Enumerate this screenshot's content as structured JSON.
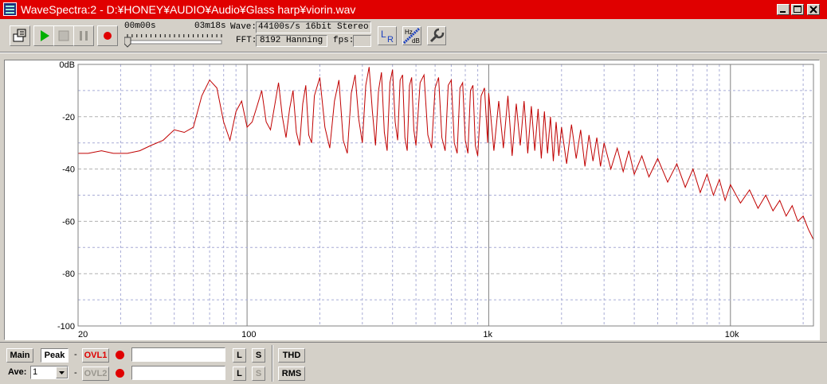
{
  "window": {
    "title": "WaveSpectra:2 - D:¥HONEY¥AUDIO¥Audio¥Glass harp¥viorin.wav",
    "icon": "wavespectra-app-icon"
  },
  "toolbar": {
    "time_start": "00m00s",
    "time_end": "03m18s",
    "wave_label": "Wave:",
    "wave_value": "44100s/s 16bit Stereo",
    "fft_label": "FFT:",
    "fft_value": "8192 Hanning",
    "fps_label": "fps:",
    "fps_value": "",
    "position_fraction": 0.0,
    "icons": [
      "open-file-icon",
      "play-icon",
      "stop-icon",
      "pause-icon",
      "record-icon",
      "lr-channel-icon",
      "hz-db-scale-icon",
      "settings-wrench-icon"
    ]
  },
  "chart_data": {
    "type": "line",
    "x_scale": "log",
    "xlim": [
      20,
      22050
    ],
    "ylim": [
      -100,
      0
    ],
    "x_ticks": [
      {
        "value": 20,
        "label": "20"
      },
      {
        "value": 100,
        "label": "100"
      },
      {
        "value": 1000,
        "label": "1k"
      },
      {
        "value": 10000,
        "label": "10k"
      }
    ],
    "y_ticks": [
      {
        "value": 0,
        "label": "0dB"
      },
      {
        "value": -20,
        "label": "-20"
      },
      {
        "value": -40,
        "label": "-40"
      },
      {
        "value": -60,
        "label": "-60"
      },
      {
        "value": -80,
        "label": "-80"
      },
      {
        "value": -100,
        "label": "-100"
      }
    ],
    "grid": true,
    "line_color": "#c00000",
    "series": [
      {
        "x": [
          20,
          22,
          25,
          28,
          32,
          36,
          40,
          45,
          50,
          55,
          60,
          65,
          70,
          75,
          80,
          85,
          90,
          95,
          100,
          105,
          110,
          115,
          120,
          125,
          130,
          135,
          140,
          145,
          150,
          155,
          160,
          165,
          170,
          175,
          180,
          185,
          190,
          200,
          210,
          220,
          230,
          240,
          250,
          260,
          270,
          280,
          290,
          300,
          310,
          320,
          330,
          340,
          350,
          360,
          370,
          380,
          390,
          400,
          410,
          420,
          430,
          440,
          450,
          460,
          470,
          480,
          490,
          500,
          520,
          540,
          560,
          580,
          600,
          620,
          640,
          660,
          680,
          700,
          720,
          740,
          760,
          780,
          800,
          820,
          840,
          860,
          880,
          900,
          930,
          960,
          990,
          1000,
          1050,
          1100,
          1150,
          1200,
          1250,
          1300,
          1350,
          1400,
          1450,
          1500,
          1550,
          1600,
          1650,
          1700,
          1750,
          1800,
          1850,
          1900,
          1950,
          2000,
          2100,
          2200,
          2300,
          2400,
          2500,
          2600,
          2700,
          2800,
          2900,
          3000,
          3200,
          3400,
          3600,
          3800,
          4000,
          4300,
          4600,
          5000,
          5500,
          6000,
          6500,
          7000,
          7500,
          8000,
          8500,
          9000,
          9500,
          10000,
          11000,
          12000,
          13000,
          14000,
          15000,
          16000,
          17000,
          18000,
          19000,
          20000,
          21000,
          22050
        ],
        "y": [
          -34,
          -34,
          -33,
          -34,
          -34,
          -33,
          -31,
          -29,
          -25,
          -26,
          -24,
          -12,
          -6,
          -9,
          -22,
          -29,
          -18,
          -14,
          -24,
          -22,
          -16,
          -10,
          -22,
          -25,
          -16,
          -7,
          -20,
          -28,
          -17,
          -10,
          -26,
          -31,
          -15,
          -8,
          -27,
          -30,
          -12,
          -5,
          -24,
          -32,
          -14,
          -6,
          -29,
          -34,
          -11,
          -4,
          -21,
          -30,
          -8,
          -1,
          -18,
          -31,
          -10,
          -3,
          -26,
          -33,
          -7,
          -2,
          -22,
          -29,
          -6,
          -4,
          -28,
          -33,
          -8,
          -5,
          -25,
          -31,
          -7,
          -4,
          -27,
          -32,
          -9,
          -5,
          -28,
          -33,
          -8,
          -6,
          -30,
          -34,
          -9,
          -7,
          -29,
          -34,
          -10,
          -8,
          -31,
          -35,
          -12,
          -9,
          -30,
          -11,
          -33,
          -14,
          -32,
          -12,
          -35,
          -15,
          -31,
          -14,
          -34,
          -16,
          -33,
          -17,
          -36,
          -18,
          -34,
          -20,
          -37,
          -22,
          -35,
          -24,
          -38,
          -23,
          -36,
          -25,
          -39,
          -27,
          -37,
          -28,
          -39,
          -30,
          -40,
          -32,
          -41,
          -33,
          -42,
          -35,
          -43,
          -36,
          -45,
          -38,
          -47,
          -40,
          -49,
          -42,
          -50,
          -44,
          -52,
          -46,
          -53,
          -48,
          -55,
          -50,
          -56,
          -52,
          -58,
          -54,
          -60,
          -58,
          -63,
          -67
        ]
      }
    ]
  },
  "bottom": {
    "main_label": "Main",
    "peak_label": "Peak",
    "ave_label": "Ave:",
    "ave_value": "1",
    "ovl1_label": "OVL1",
    "ovl2_label": "OVL2",
    "l_label": "L",
    "s_label": "S",
    "dash": "-",
    "thd_label": "THD",
    "rms_label": "RMS",
    "input1_value": "",
    "input2_value": ""
  }
}
